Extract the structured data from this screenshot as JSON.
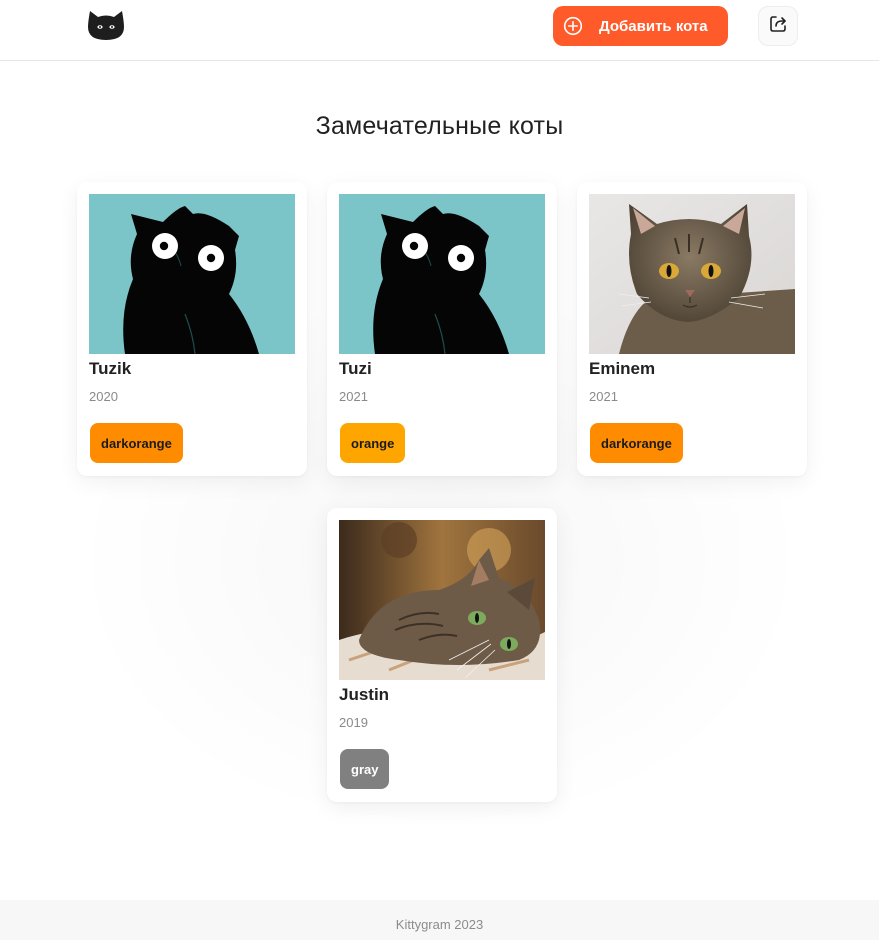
{
  "header": {
    "add_button_label": "Добавить кота",
    "accent_color": "#ff5a2a"
  },
  "page": {
    "title": "Замечательные коты"
  },
  "cats": [
    {
      "name": "Tuzik",
      "year": "2020",
      "color": "darkorange",
      "color_hex": "#ff8c00",
      "image": "cartoon-cat"
    },
    {
      "name": "Tuzi",
      "year": "2021",
      "color": "orange",
      "color_hex": "#ffa500",
      "image": "cartoon-cat"
    },
    {
      "name": "Eminem",
      "year": "2021",
      "color": "darkorange",
      "color_hex": "#ff8c00",
      "image": "tabby-cat-photo"
    },
    {
      "name": "Justin",
      "year": "2019",
      "color": "gray",
      "color_hex": "#808080",
      "image": "lying-cat-photo"
    }
  ],
  "footer": {
    "text": "Kittygram 2023"
  }
}
